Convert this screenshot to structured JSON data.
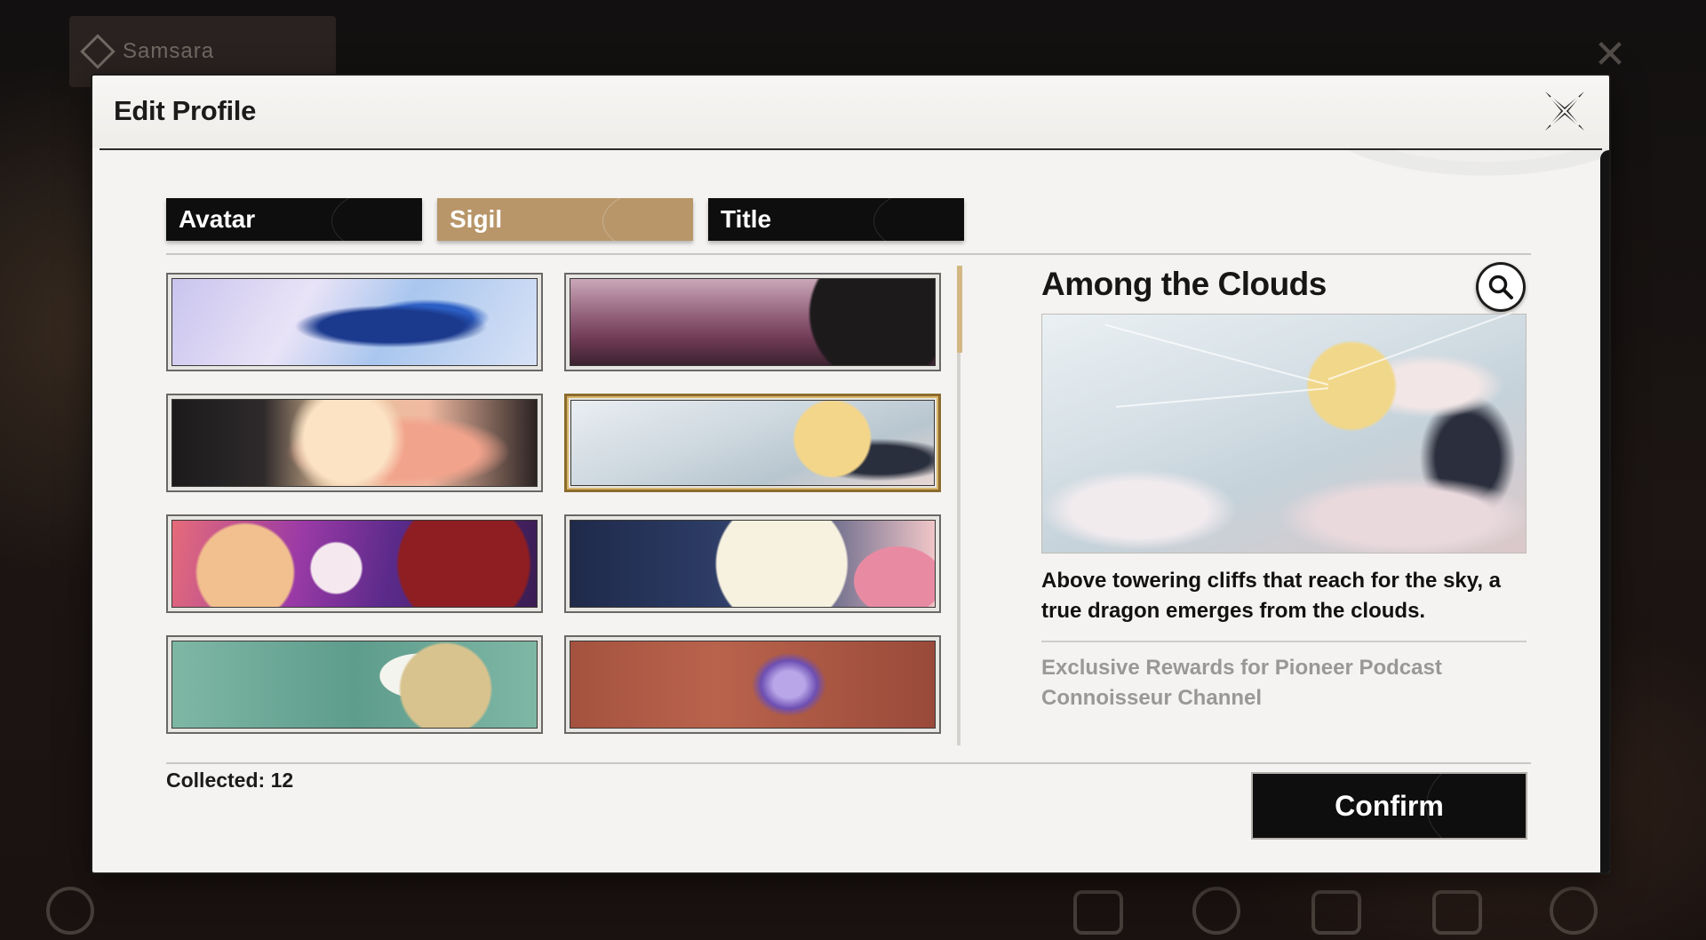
{
  "background": {
    "topbar_label": "Samsara",
    "icons": [
      "power-icon",
      "mail-icon",
      "clock-icon",
      "bookmark-icon",
      "camera-icon",
      "settings-icon"
    ]
  },
  "modal": {
    "title": "Edit Profile",
    "close_icon": "close-x-icon"
  },
  "tabs": [
    {
      "label": "Avatar",
      "active": false
    },
    {
      "label": "Sigil",
      "active": true
    },
    {
      "label": "Title",
      "active": false
    }
  ],
  "sigils": [
    {
      "art": "blue-dragon-skyline",
      "selected": false
    },
    {
      "art": "black-cat-pink-valley",
      "selected": false
    },
    {
      "art": "moon-blossom-tree",
      "selected": false
    },
    {
      "art": "among-the-clouds",
      "selected": true
    },
    {
      "art": "party-characters-purple",
      "selected": false
    },
    {
      "art": "full-moon-night",
      "selected": false
    },
    {
      "art": "teal-map-winged-emblem",
      "selected": false
    },
    {
      "art": "purple-crystal-red",
      "selected": false
    }
  ],
  "detail": {
    "name": "Among the Clouds",
    "search_icon": "magnifier-icon",
    "description": "Above towering cliffs that reach for the sky, a true dragon emerges from the clouds.",
    "source": "Exclusive Rewards for Pioneer Podcast Connoisseur Channel"
  },
  "footer": {
    "collected": "Collected: 12",
    "confirm_label": "Confirm"
  },
  "colors": {
    "active_tab": "#b89669",
    "tab": "#0f0e0e",
    "selected_border": "#8c6b2e",
    "scroll_thumb": "#d3b782"
  }
}
